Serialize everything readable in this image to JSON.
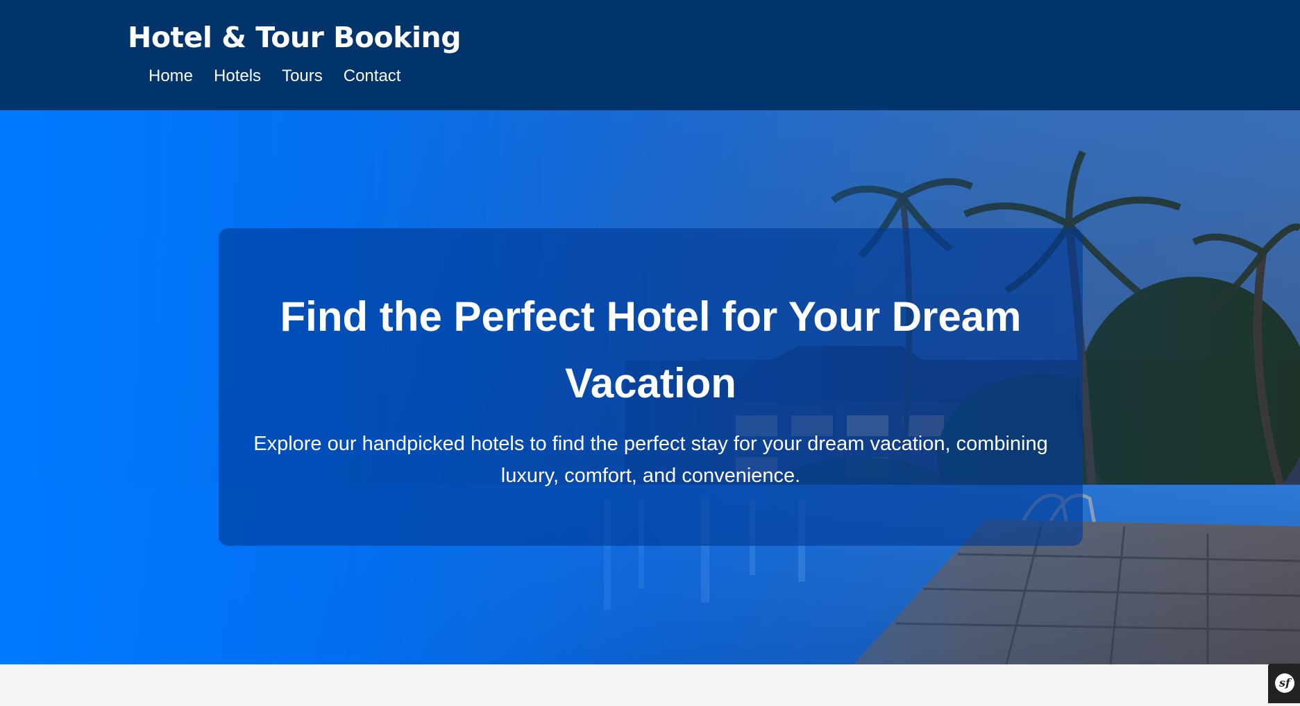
{
  "header": {
    "title": "Hotel & Tour Booking",
    "nav": [
      "Home",
      "Hotels",
      "Tours",
      "Contact"
    ]
  },
  "hero": {
    "heading": "Find the Perfect Hotel for Your Dream Vacation",
    "description": "Explore our handpicked hotels to find the perfect stay for your dream vacation, combining luxury, comfort, and convenience."
  },
  "debug_toolbar": {
    "logo": "sf"
  },
  "colors": {
    "header_bg": "#00346b",
    "hero_blue": "#0077ff",
    "text": "#ffffff",
    "page_bg": "#f4f4f4"
  },
  "icons": {
    "toolbar": "symfony-logo-icon"
  }
}
